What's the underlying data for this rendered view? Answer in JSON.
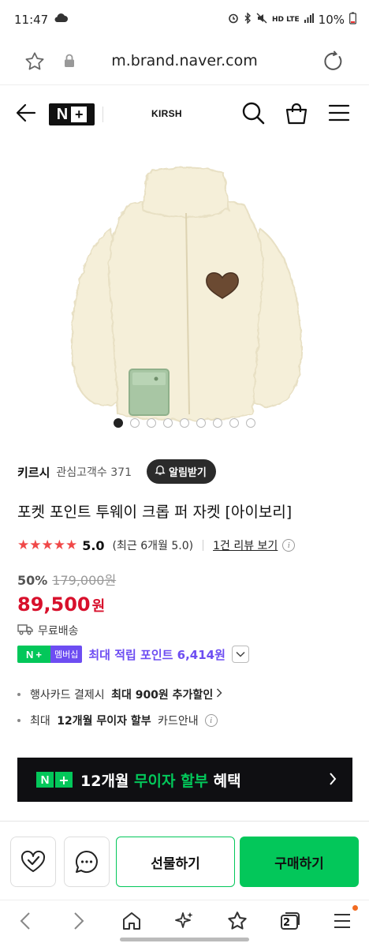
{
  "status_bar": {
    "time": "11:47",
    "network": "HD LTE",
    "battery": "10%"
  },
  "browser": {
    "url": "m.brand.naver.com"
  },
  "header": {
    "logo_letter": "N",
    "logo_plus": "+",
    "brand": "KIRSH"
  },
  "gallery": {
    "dot_count": 9,
    "active_index": 0
  },
  "store": {
    "name": "키르시",
    "followers_label": "관심고객수 371",
    "alarm_label": "알림받기"
  },
  "product": {
    "title": "포켓 포인트 투웨이 크롭 퍼 자켓 [아이보리]",
    "stars": "★★★★★",
    "rating": "5.0",
    "recent_rating": "(최근 6개월 5.0)",
    "review_link": "1건 리뷰 보기",
    "info_glyph": "i",
    "discount": "50%",
    "original_price": "179,000원",
    "sale_price": "89,500",
    "currency": "원",
    "shipping": "무료배송"
  },
  "points": {
    "badge_n": "N",
    "badge_plus": "+",
    "badge_member": "멤버십",
    "text": "최대 적립 포인트 6,414원"
  },
  "benefits": [
    {
      "prefix": "행사카드 결제시 ",
      "bold": "최대 900원 추가할인",
      "suffix": ""
    },
    {
      "prefix": "최대 ",
      "bold": "12개월 무이자 할부",
      "suffix": " 카드안내"
    }
  ],
  "banner": {
    "n": "N",
    "plus": "+",
    "text_a": "12개월 ",
    "text_green": "무이자 할부",
    "text_b": " 혜택"
  },
  "actions": {
    "gift_label": "선물하기",
    "buy_label": "구매하기"
  },
  "browser_nav": {
    "tabs_count": "2"
  },
  "colors": {
    "naver_green": "#03c75a",
    "sale_red": "#d8102c",
    "star_red": "#f04848",
    "membership_purple": "#6d4df2"
  }
}
